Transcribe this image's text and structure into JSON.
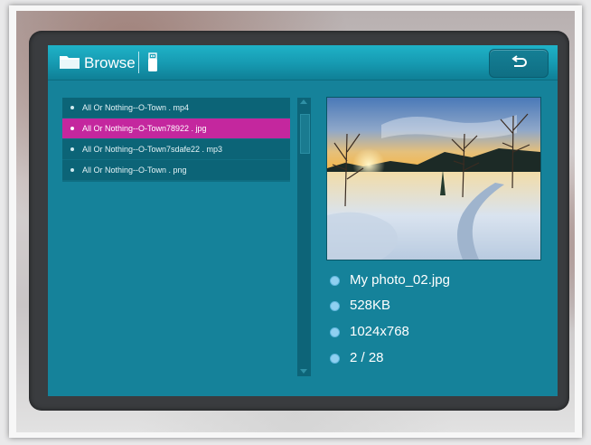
{
  "header": {
    "title": "Browse",
    "icons": {
      "folder": "folder-icon",
      "usb": "usb-drive-icon",
      "back": "return-arrow-icon"
    }
  },
  "file_list": {
    "items": [
      {
        "label": "All Or Nothing--O-Town . mp4",
        "selected": false
      },
      {
        "label": "All Or Nothing--O-Town78922 . jpg",
        "selected": true
      },
      {
        "label": "All Or Nothing--O-Town7sdafe22 . mp3",
        "selected": false
      },
      {
        "label": "All Or Nothing--O-Town . png",
        "selected": false
      }
    ]
  },
  "details": {
    "filename": "My photo_02.jpg",
    "size": "528KB",
    "resolution": "1024x768",
    "position": "2 / 28"
  },
  "colors": {
    "screen": "#15829a",
    "header": "#1699b0",
    "selection": "#c4279e",
    "bezel": "#3a3c3f"
  }
}
